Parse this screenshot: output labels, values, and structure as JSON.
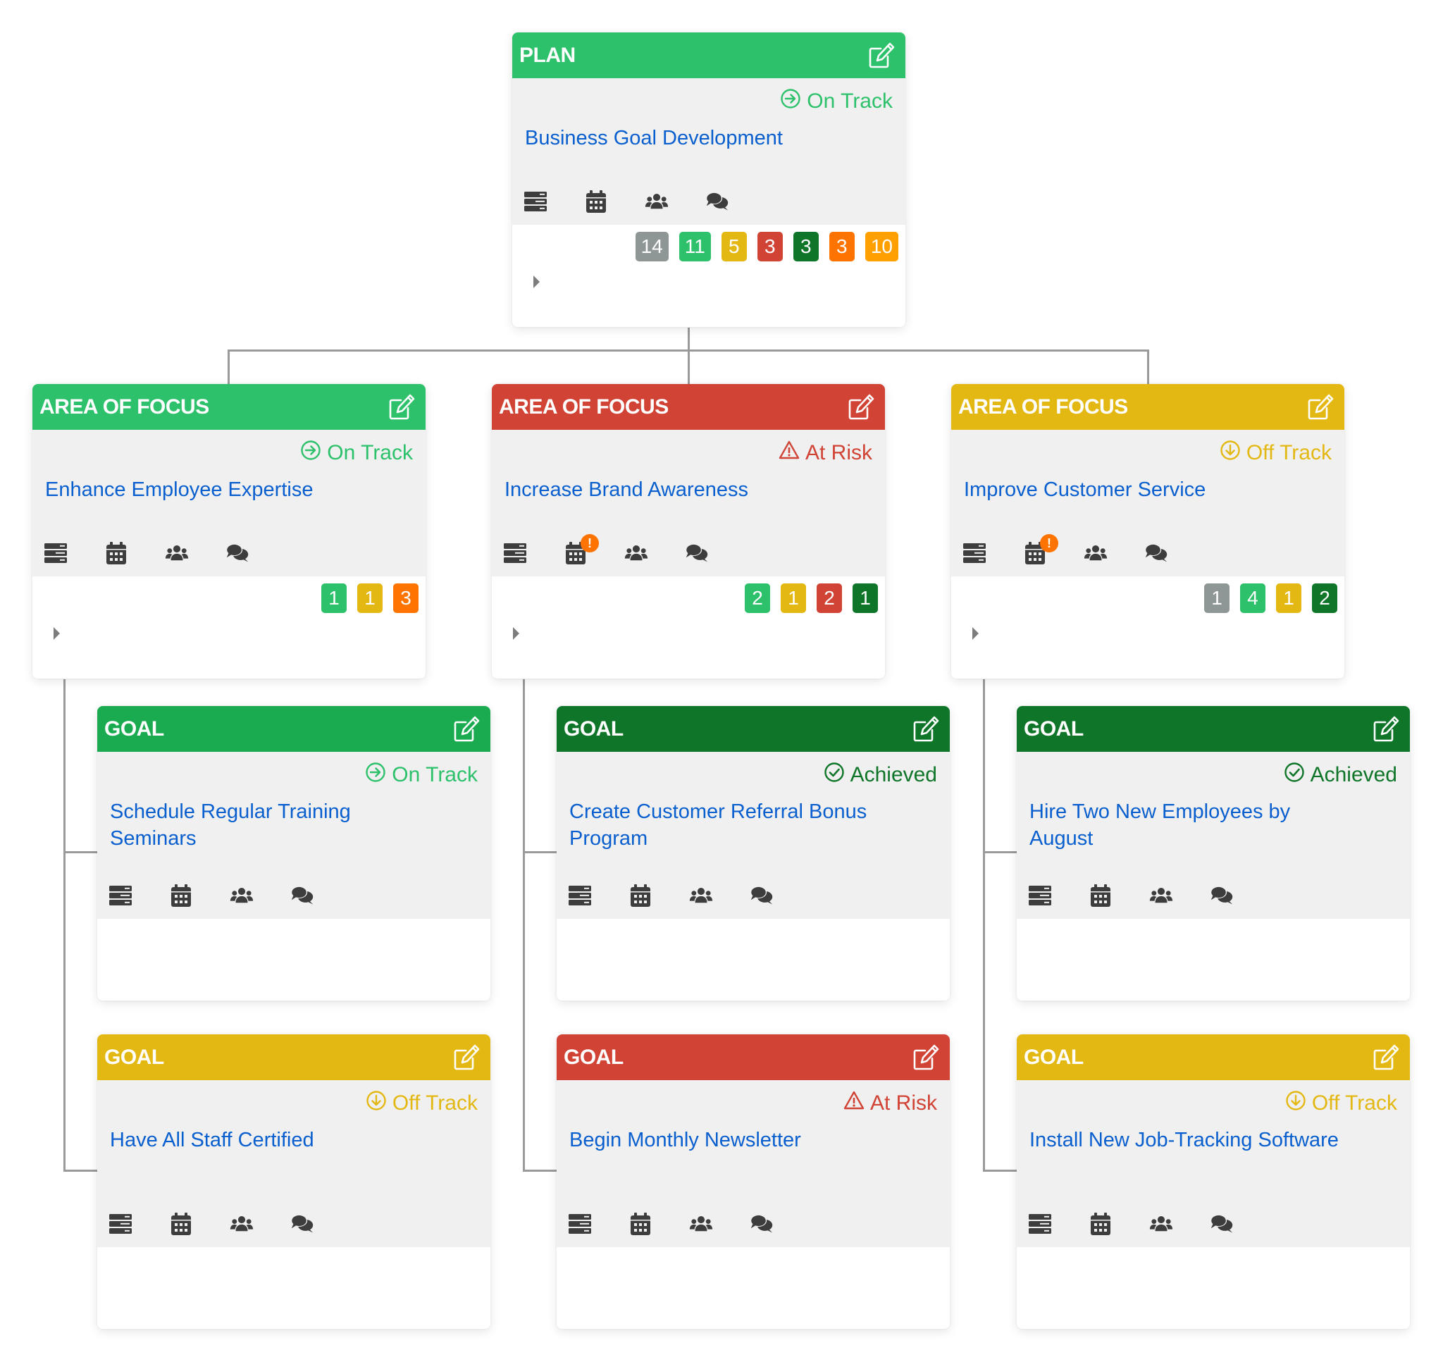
{
  "colors": {
    "on_track": "#2ec16b",
    "on_track_goal": "#1aab50",
    "at_risk": "#d14335",
    "off_track": "#e4b812",
    "achieved": "#0f7629",
    "not_started": "#8f9696",
    "orange": "#ff7300",
    "amber": "#ff9f00",
    "title_blue": "#0a5fcf",
    "icon_dark": "#3d3d3d"
  },
  "icons": {
    "edit": "edit-icon",
    "details": "list-icon",
    "calendar": "calendar-icon",
    "people": "users-icon",
    "comments": "comments-icon",
    "expand": "caret-right-icon"
  },
  "plan": {
    "type_label": "PLAN",
    "status": "On Track",
    "status_key": "on_track",
    "title": "Business Goal Development",
    "counts": [
      {
        "value": "14",
        "color": "#8f9696"
      },
      {
        "value": "11",
        "color": "#2ec16b"
      },
      {
        "value": "5",
        "color": "#e4b812"
      },
      {
        "value": "3",
        "color": "#d14335"
      },
      {
        "value": "3",
        "color": "#0f7629"
      },
      {
        "value": "3",
        "color": "#ff7300"
      },
      {
        "value": "10",
        "color": "#ff9f00"
      }
    ]
  },
  "areas": [
    {
      "type_label": "AREA OF FOCUS",
      "status": "On Track",
      "status_key": "on_track",
      "title": "Enhance Employee Expertise",
      "calendar_alert": false,
      "counts": [
        {
          "value": "1",
          "color": "#2ec16b"
        },
        {
          "value": "1",
          "color": "#e4b812"
        },
        {
          "value": "3",
          "color": "#ff7300"
        }
      ],
      "goals": [
        {
          "type_label": "GOAL",
          "status": "On Track",
          "status_key": "on_track_goal",
          "title": "Schedule Regular Training Seminars"
        },
        {
          "type_label": "GOAL",
          "status": "Off Track",
          "status_key": "off_track",
          "title": "Have All Staff Certified"
        }
      ]
    },
    {
      "type_label": "AREA OF FOCUS",
      "status": "At Risk",
      "status_key": "at_risk",
      "title": "Increase Brand Awareness",
      "calendar_alert": true,
      "counts": [
        {
          "value": "2",
          "color": "#2ec16b"
        },
        {
          "value": "1",
          "color": "#e4b812"
        },
        {
          "value": "2",
          "color": "#d14335"
        },
        {
          "value": "1",
          "color": "#0f7629"
        }
      ],
      "goals": [
        {
          "type_label": "GOAL",
          "status": "Achieved",
          "status_key": "achieved",
          "title": "Create Customer Referral Bonus Program"
        },
        {
          "type_label": "GOAL",
          "status": "At Risk",
          "status_key": "at_risk",
          "title": "Begin Monthly Newsletter"
        }
      ]
    },
    {
      "type_label": "AREA OF FOCUS",
      "status": "Off Track",
      "status_key": "off_track",
      "title": "Improve Customer Service",
      "calendar_alert": true,
      "counts": [
        {
          "value": "1",
          "color": "#8f9696"
        },
        {
          "value": "4",
          "color": "#2ec16b"
        },
        {
          "value": "1",
          "color": "#e4b812"
        },
        {
          "value": "2",
          "color": "#0f7629"
        }
      ],
      "goals": [
        {
          "type_label": "GOAL",
          "status": "Achieved",
          "status_key": "achieved",
          "title": "Hire Two New Employees by August"
        },
        {
          "type_label": "GOAL",
          "status": "Off Track",
          "status_key": "off_track",
          "title": "Install New Job-Tracking Software"
        }
      ]
    }
  ],
  "calendar_alert_mark": "!"
}
